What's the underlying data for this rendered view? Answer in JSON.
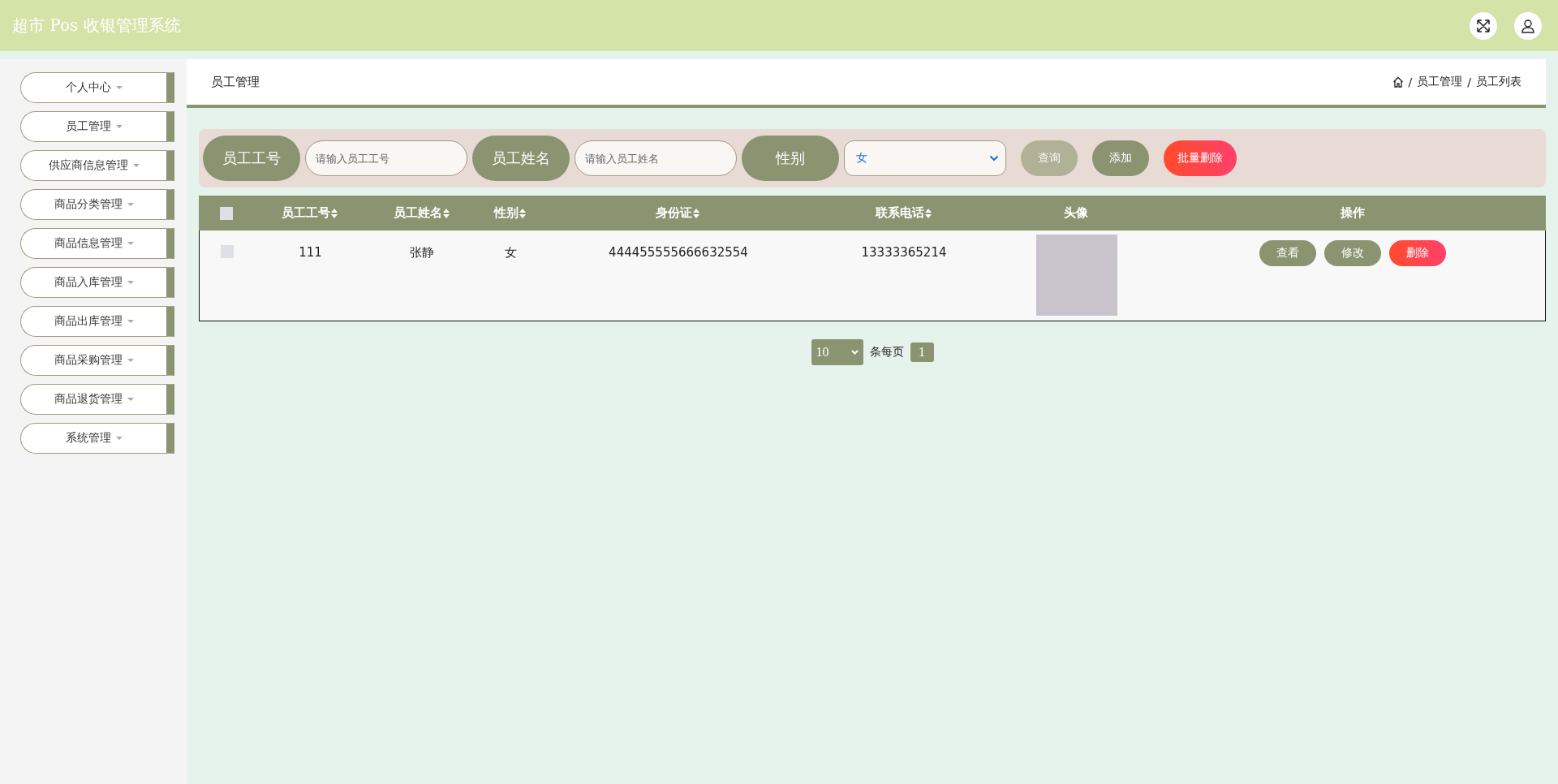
{
  "header": {
    "title": "超市 Pos 收银管理系统"
  },
  "sidebar": {
    "items": [
      {
        "label": "个人中心"
      },
      {
        "label": "员工管理"
      },
      {
        "label": "供应商信息管理"
      },
      {
        "label": "商品分类管理"
      },
      {
        "label": "商品信息管理"
      },
      {
        "label": "商品入库管理"
      },
      {
        "label": "商品出库管理"
      },
      {
        "label": "商品采购管理"
      },
      {
        "label": "商品退货管理"
      },
      {
        "label": "系统管理"
      }
    ]
  },
  "page_title": "员工管理",
  "breadcrumb": [
    {
      "separator": "/",
      "label": "员工管理"
    },
    {
      "separator": "/",
      "label": "员工列表"
    }
  ],
  "search": {
    "fields": [
      {
        "kind": "input",
        "label": "员工工号",
        "placeholder": "请输入员工工号"
      },
      {
        "kind": "input",
        "label": "员工姓名",
        "placeholder": "请输入员工姓名"
      },
      {
        "kind": "select",
        "label": "性别",
        "value": "女"
      }
    ],
    "buttons": [
      {
        "label": "查询",
        "kind": "plain",
        "hovered": true
      },
      {
        "label": "添加",
        "kind": "plain",
        "hovered": false
      },
      {
        "label": "批量删除",
        "kind": "danger",
        "hovered": false
      }
    ]
  },
  "table": {
    "select_all": {
      "checked": false
    },
    "columns": [
      {
        "label": "员工工号",
        "sortable": true
      },
      {
        "label": "员工姓名",
        "sortable": true
      },
      {
        "label": "性别",
        "sortable": true
      },
      {
        "label": "身份证",
        "sortable": true
      },
      {
        "label": "联系电话",
        "sortable": true
      },
      {
        "label": "头像",
        "sortable": false
      },
      {
        "label": "操作",
        "sortable": false
      }
    ],
    "rows": [
      {
        "selected": false,
        "cells": [
          "111",
          "张静",
          "女",
          "444455555666632554",
          "13333365214"
        ],
        "actions": [
          {
            "label": "查看",
            "kind": "plain"
          },
          {
            "label": "修改",
            "kind": "plain"
          },
          {
            "label": "删除",
            "kind": "danger"
          }
        ]
      }
    ]
  },
  "pagination": {
    "page_size": "10",
    "page_size_label": "条每页",
    "pages": [
      {
        "label": "1",
        "selected": true
      }
    ]
  }
}
